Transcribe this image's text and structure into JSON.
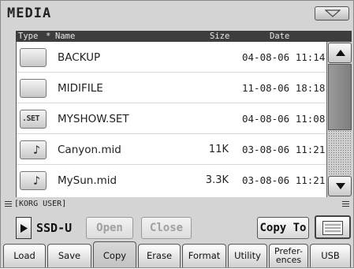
{
  "window": {
    "title": "MEDIA"
  },
  "header": {
    "type_label": "Type",
    "sort_marker": "*",
    "name_label": "Name",
    "size_label": "Size",
    "date_label": "Date"
  },
  "files": [
    {
      "icon": "folder-icon",
      "ext": "",
      "name": "BACKUP",
      "size": "",
      "date": "04-08-06 11:14"
    },
    {
      "icon": "folder-icon",
      "ext": "",
      "name": "MIDIFILE",
      "size": "",
      "date": "11-08-06 18:18"
    },
    {
      "icon": "set-file-icon",
      "ext": ".SET",
      "name": "MYSHOW.SET",
      "size": "",
      "date": "04-08-06 11:08"
    },
    {
      "icon": "midi-file-icon",
      "ext": "",
      "name": "Canyon.mid",
      "size": "11K",
      "date": "03-08-06 11:21"
    },
    {
      "icon": "midi-file-icon",
      "ext": "",
      "name": "MySun.mid",
      "size": "3.3K",
      "date": "03-08-06 11:21"
    }
  ],
  "path": "[KORG USER]",
  "device": {
    "label": "SSD-U"
  },
  "buttons": {
    "open": "Open",
    "close": "Close",
    "copy_to": "Copy To"
  },
  "tabs": [
    {
      "label": "Load",
      "active": false
    },
    {
      "label": "Save",
      "active": false
    },
    {
      "label": "Copy",
      "active": true
    },
    {
      "label": "Erase",
      "active": false
    },
    {
      "label": "Format",
      "active": false
    },
    {
      "label": "Utility",
      "active": false
    },
    {
      "label_line1": "Prefer-",
      "label_line2": "ences",
      "active": false
    },
    {
      "label": "USB",
      "active": false
    }
  ],
  "colors": {
    "screen_bg": "#d4d4d4",
    "header_bg": "#3d3d3d",
    "list_bg": "#ffffff",
    "disabled_text": "#a0a0a0"
  }
}
